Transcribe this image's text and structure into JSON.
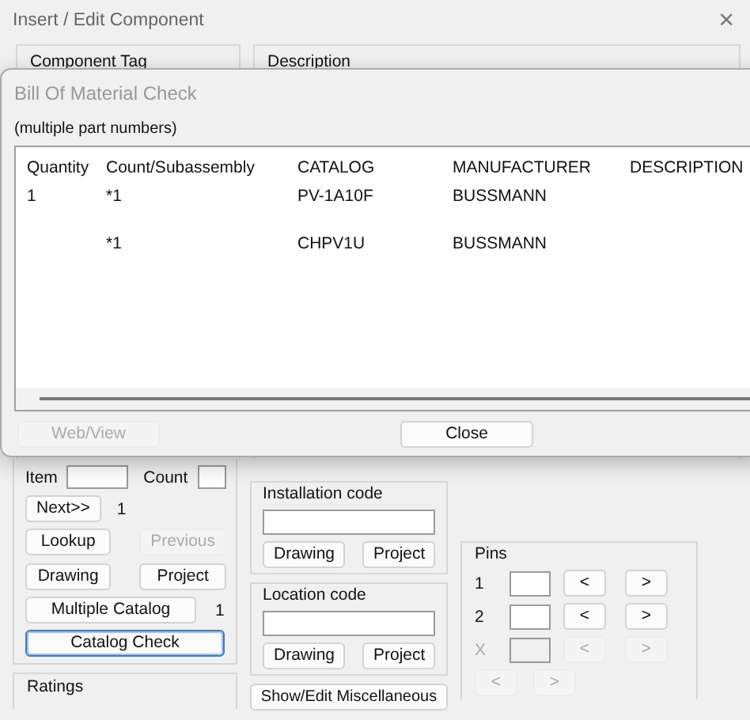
{
  "window": {
    "title": "Insert / Edit Component",
    "close": "×"
  },
  "top_groups": [
    {
      "label": "Component Tag"
    },
    {
      "label": "Description"
    }
  ],
  "dialog": {
    "title": "Bill Of Material Check",
    "subtitle": "(multiple part numbers)",
    "table": {
      "columns": [
        "Quantity",
        "Count/Subassembly",
        "CATALOG",
        "MANUFACTURER",
        "DESCRIPTION"
      ],
      "rows": [
        {
          "quantity": "1",
          "count": "*1",
          "catalog": "PV-1A10F",
          "manufacturer": "BUSSMANN"
        },
        {
          "count": "*1",
          "catalog": "CHPV1U",
          "manufacturer": "BUSSMANN"
        }
      ]
    },
    "buttons": [
      {
        "label": "Web/View",
        "disabled": true
      },
      {
        "label": "Close",
        "disabled": false
      }
    ]
  },
  "catalog_panel": {
    "item_label": "Item",
    "count_label": "Count",
    "next_button": "Next>>",
    "next_count": "1",
    "buttons": [
      {
        "label": "Lookup",
        "disabled": false
      },
      {
        "label": "Previous",
        "disabled": true
      },
      {
        "label": "Drawing",
        "disabled": false
      },
      {
        "label": "Project",
        "disabled": false
      }
    ],
    "multiple_catalog": {
      "label": "Multiple Catalog",
      "count": "1"
    },
    "catalog_check": {
      "label": "Catalog Check",
      "focused": true
    }
  },
  "ratings": {
    "label": "Ratings"
  },
  "code_groups": [
    {
      "label": "Installation code",
      "buttons": [
        "Drawing",
        "Project"
      ]
    },
    {
      "label": "Location code",
      "buttons": [
        "Drawing",
        "Project"
      ]
    }
  ],
  "misc_button": "Show/Edit Miscellaneous",
  "pins": {
    "label": "Pins",
    "rows": [
      {
        "label": "1",
        "prev": "<",
        "next": ">",
        "disabled": false
      },
      {
        "label": "2",
        "prev": "<",
        "next": ">",
        "disabled": false
      },
      {
        "label": "X",
        "prev": "<",
        "next": ">",
        "disabled": true
      }
    ],
    "nav": [
      {
        "label": "<",
        "disabled": true
      },
      {
        "label": ">",
        "disabled": true
      }
    ]
  }
}
